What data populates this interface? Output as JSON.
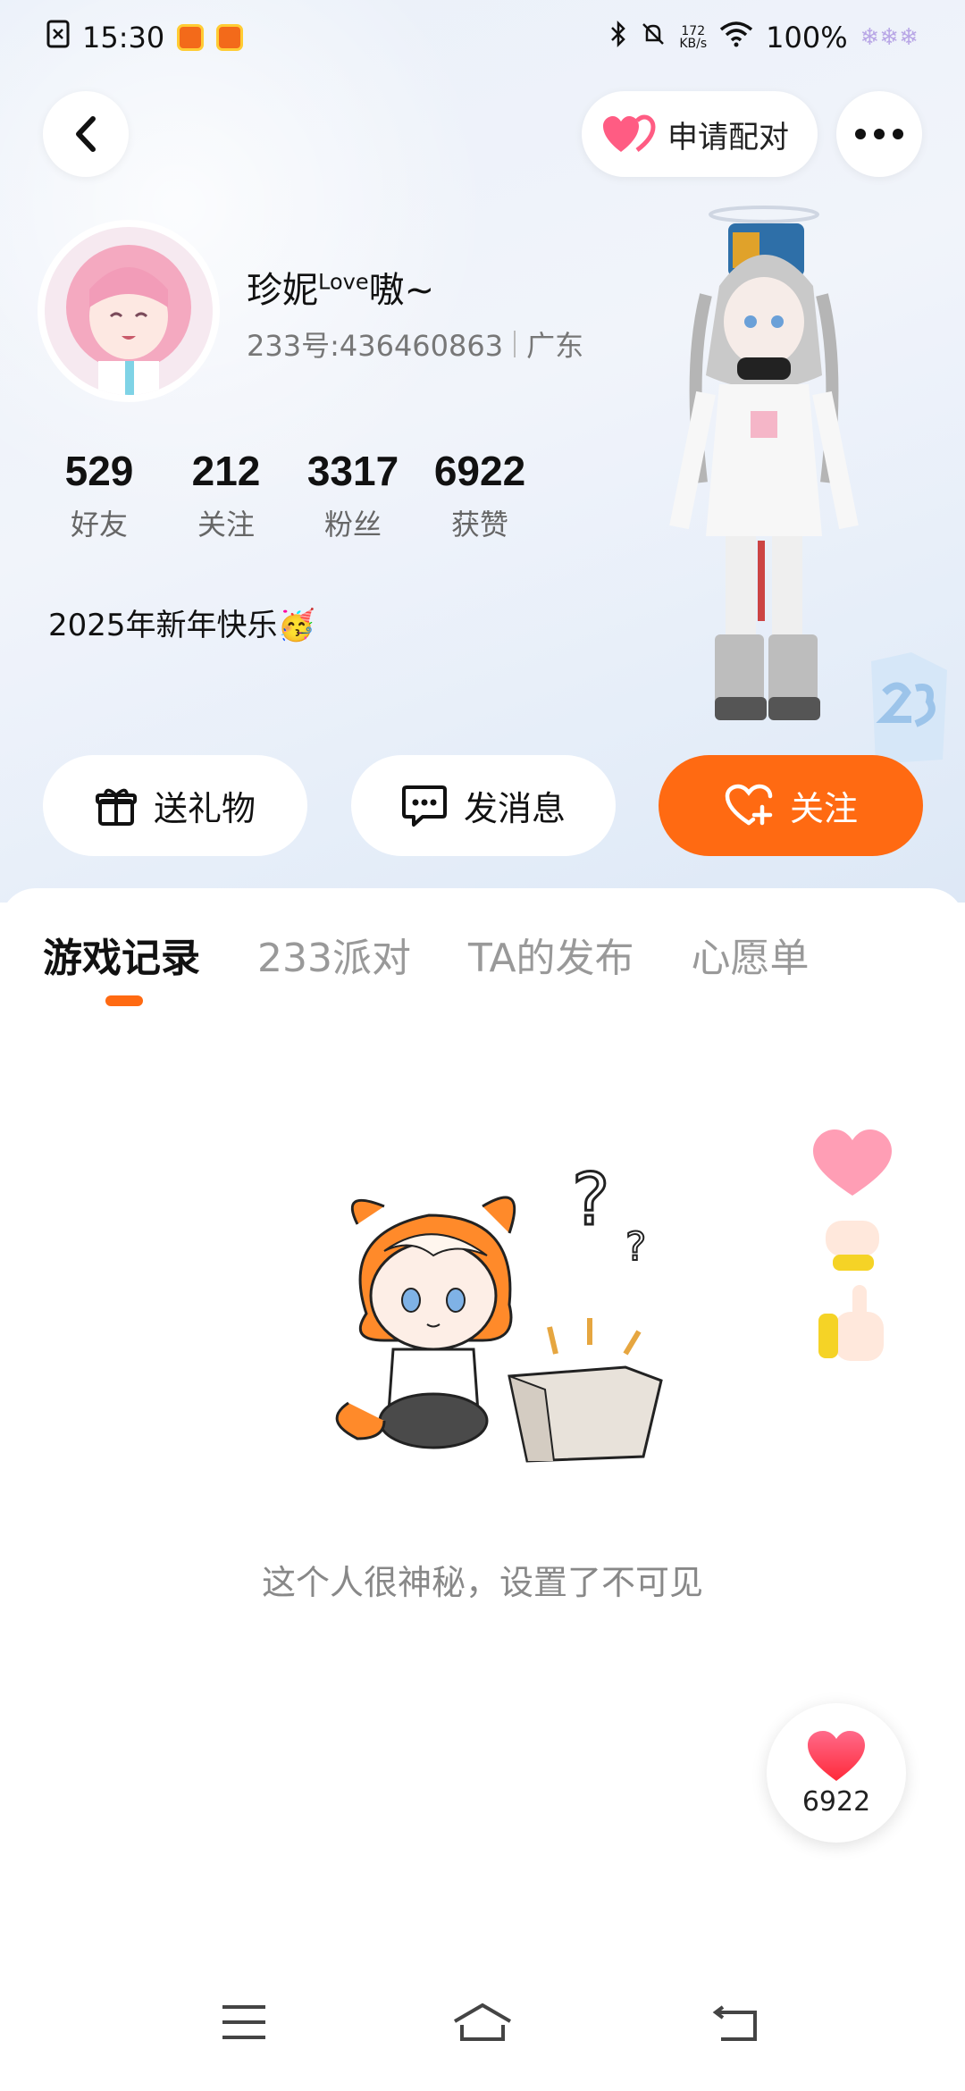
{
  "status_bar": {
    "time": "15:30",
    "speed_value": "172",
    "speed_unit": "KB/s",
    "battery": "100%"
  },
  "header": {
    "pair_button_label": "申请配对"
  },
  "profile": {
    "name": "珍妮",
    "name_sup": "Love",
    "name_suffix": "嗷~",
    "id_text": "233号:436460863",
    "location": "广东",
    "bio": "2025年新年快乐🥳",
    "stats": [
      {
        "value": "529",
        "label": "好友"
      },
      {
        "value": "212",
        "label": "关注"
      },
      {
        "value": "3317",
        "label": "粉丝"
      },
      {
        "value": "6922",
        "label": "获赞"
      }
    ]
  },
  "actions": {
    "gift": "送礼物",
    "message": "发消息",
    "follow": "关注"
  },
  "tabs": [
    "游戏记录",
    "233派对",
    "TA的发布",
    "心愿单"
  ],
  "empty_state": {
    "text": "这个人很神秘，设置了不可见"
  },
  "like_fab": {
    "count": "6922"
  },
  "colors": {
    "accent": "#ff6a12",
    "background_top": "#eaf0f9"
  }
}
